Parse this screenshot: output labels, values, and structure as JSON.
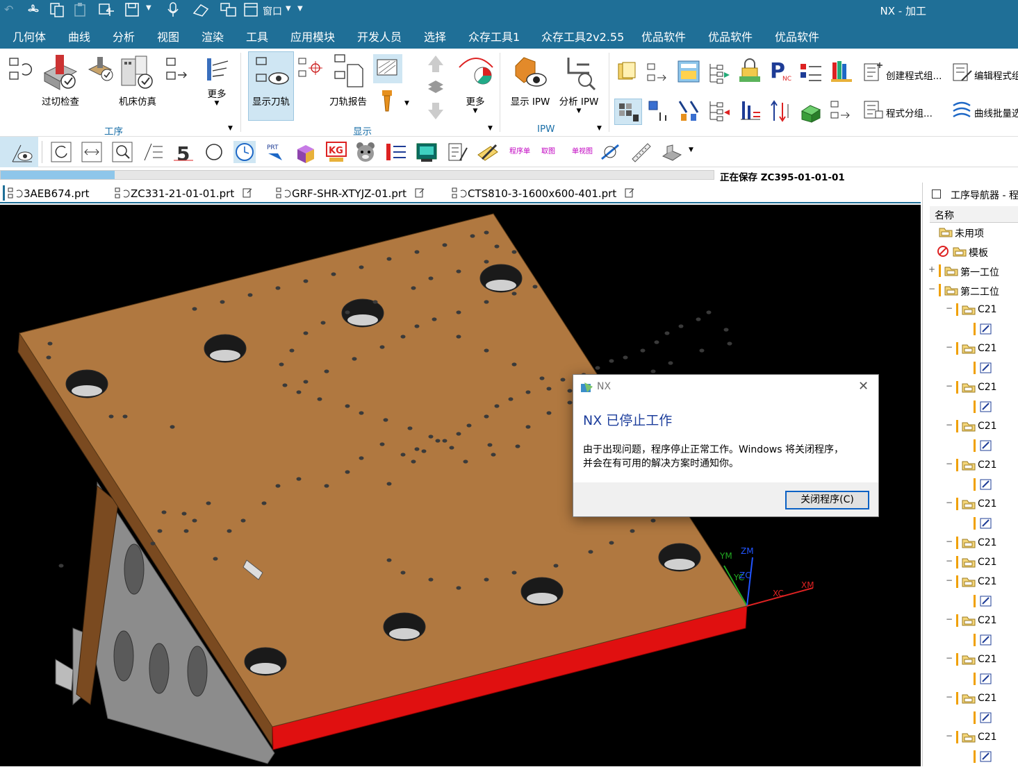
{
  "window": {
    "title": "NX - 加工",
    "quick_access": {
      "window_menu": "窗口"
    }
  },
  "menu": [
    "几何体",
    "曲线",
    "分析",
    "视图",
    "渲染",
    "工具",
    "应用模块",
    "开发人员",
    "选择",
    "众存工具1",
    "众存工具2v2.55",
    "优品软件",
    "优品软件",
    "优品软件"
  ],
  "ribbon": {
    "cut_check": "过切检查",
    "machine_sim": "机床仿真",
    "more1": "更多",
    "show_toolpath": "显示刀轨",
    "toolpath_report": "刀轨报告",
    "more2": "更多",
    "show_ipw": "显示 IPW",
    "analyze_ipw": "分析 IPW",
    "create_program_group": "创建程式组...",
    "edit_program_group": "编辑程式组",
    "program_group": "程式分组...",
    "curve_batch": "曲线批量选",
    "group_op": "工序",
    "group_display": "显示",
    "group_ipw": "IPW"
  },
  "toolbar2": {
    "program_sheet": "程序单",
    "pick_shape": "取图",
    "single_view": "单视图"
  },
  "status": {
    "saving": "正在保存 ZC395-01-01-01",
    "progress": 0.16
  },
  "tabs": [
    "3AEB674.prt",
    "ZC331-21-01-01.prt",
    "GRF-SHR-XTYJZ-01.prt",
    "CTS810-3-1600x600-401.prt"
  ],
  "viewport": {
    "axes": {
      "ym": "YM",
      "zm": "ZM",
      "yc": "YC",
      "zc": "ZC",
      "xc": "XC",
      "xm": "XM"
    }
  },
  "navigator": {
    "title": "工序导航器 - 程",
    "column_name": "名称",
    "rows": [
      {
        "label": "未用项",
        "level": 0
      },
      {
        "label": "模板",
        "level": 0
      },
      {
        "label": "第一工位",
        "level": 0
      },
      {
        "label": "第二工位",
        "level": 0
      },
      {
        "label": "C21",
        "level": 1
      },
      {
        "label": "",
        "level": 2
      },
      {
        "label": "C21",
        "level": 1
      },
      {
        "label": "",
        "level": 2
      },
      {
        "label": "C21",
        "level": 1
      },
      {
        "label": "",
        "level": 2
      },
      {
        "label": "C21",
        "level": 1
      },
      {
        "label": "",
        "level": 2
      },
      {
        "label": "C21",
        "level": 1
      },
      {
        "label": "",
        "level": 2
      },
      {
        "label": "C21",
        "level": 1
      },
      {
        "label": "",
        "level": 2
      },
      {
        "label": "C21",
        "level": 1
      },
      {
        "label": "C21",
        "level": 1
      },
      {
        "label": "C21",
        "level": 1
      },
      {
        "label": "",
        "level": 2
      },
      {
        "label": "C21",
        "level": 1
      },
      {
        "label": "",
        "level": 2
      },
      {
        "label": "C21",
        "level": 1
      },
      {
        "label": "",
        "level": 2
      },
      {
        "label": "C21",
        "level": 1
      },
      {
        "label": "",
        "level": 2
      },
      {
        "label": "C21",
        "level": 1
      },
      {
        "label": "",
        "level": 2
      }
    ]
  },
  "dialog": {
    "app": "NX",
    "heading": "NX 已停止工作",
    "line1": "由于出现问题，程序停止正常工作。Windows 将关闭程序，",
    "line2": "并会在有可用的解决方案时通知你。",
    "close_button": "关闭程序(C)"
  },
  "colors": {
    "chrome": "#1f6f97",
    "plate_top": "#b07840",
    "plate_side": "#e01010",
    "bracket": "#8e8e8e",
    "dialog_heading": "#1d3e9c"
  }
}
